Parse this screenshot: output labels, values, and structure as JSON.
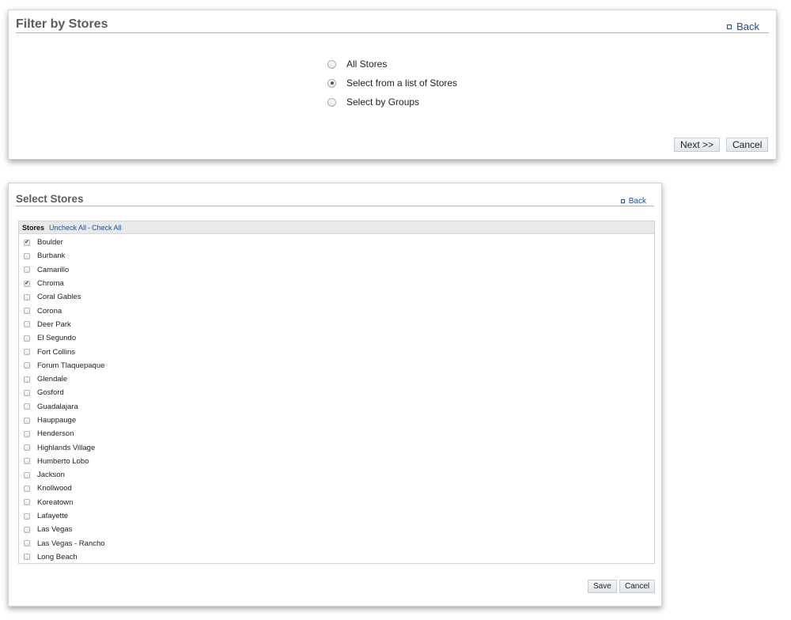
{
  "filter_panel": {
    "title": "Filter by Stores",
    "back_label": "Back",
    "options": [
      {
        "label": "All Stores",
        "checked": false
      },
      {
        "label": "Select from a list of Stores",
        "checked": true
      },
      {
        "label": "Select by Groups",
        "checked": false
      }
    ],
    "next_label": "Next >>",
    "cancel_label": "Cancel"
  },
  "stores_panel": {
    "title": "Select Stores",
    "back_label": "Back",
    "list_header": {
      "label": "Stores",
      "uncheck_all": "Uncheck All",
      "separator": "-",
      "check_all": "Check All"
    },
    "stores": [
      {
        "name": "Boulder",
        "checked": true
      },
      {
        "name": "Burbank",
        "checked": false
      },
      {
        "name": "Camarillo",
        "checked": false
      },
      {
        "name": "Chroma",
        "checked": true
      },
      {
        "name": "Coral Gables",
        "checked": false
      },
      {
        "name": "Corona",
        "checked": false
      },
      {
        "name": "Deer Park",
        "checked": false
      },
      {
        "name": "El Segundo",
        "checked": false
      },
      {
        "name": "Fort Collins",
        "checked": false
      },
      {
        "name": "Forum Tlaquepaque",
        "checked": false
      },
      {
        "name": "Glendale",
        "checked": false
      },
      {
        "name": "Gosford",
        "checked": false
      },
      {
        "name": "Guadalajara",
        "checked": false
      },
      {
        "name": "Hauppauge",
        "checked": false
      },
      {
        "name": "Henderson",
        "checked": false
      },
      {
        "name": "Highlands Village",
        "checked": false
      },
      {
        "name": "Humberto Lobo",
        "checked": false
      },
      {
        "name": "Jackson",
        "checked": false
      },
      {
        "name": "Knollwood",
        "checked": false
      },
      {
        "name": "Koreatown",
        "checked": false
      },
      {
        "name": "Lafayette",
        "checked": false
      },
      {
        "name": "Las Vegas",
        "checked": false
      },
      {
        "name": "Las Vegas - Rancho",
        "checked": false
      },
      {
        "name": "Long Beach",
        "checked": false
      }
    ],
    "save_label": "Save",
    "cancel_label": "Cancel"
  }
}
